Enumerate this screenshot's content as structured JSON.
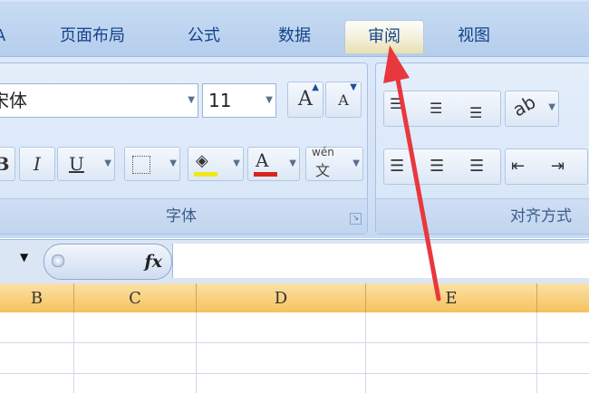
{
  "tabs": [
    {
      "label": "A"
    },
    {
      "label": "页面布局"
    },
    {
      "label": "公式"
    },
    {
      "label": "数据"
    },
    {
      "label": "审阅"
    },
    {
      "label": "视图"
    }
  ],
  "active_tab": "审阅",
  "font_group": {
    "font_name": "宋体",
    "font_size": "11",
    "grow_font_label": "A",
    "shrink_font_label": "A",
    "bold_label": "B",
    "italic_label": "I",
    "underline_label": "U",
    "font_color_label": "A",
    "phonetic_label": "wén",
    "label": "字体"
  },
  "alignment_group": {
    "label": "对齐方式"
  },
  "formula_bar": {
    "fx_label": "fx",
    "value": ""
  },
  "columns": [
    "B",
    "C",
    "D",
    "E"
  ],
  "colors": {
    "arrow": "#e8383d",
    "column_header": "#f6c25c",
    "tab_text": "#15428b"
  },
  "icons": [
    "dropdown-arrow-icon",
    "grow-font-icon",
    "shrink-font-icon",
    "border-icon",
    "fill-color-icon",
    "font-color-icon",
    "phonetic-icon",
    "align-top-icon",
    "align-middle-icon",
    "align-bottom-icon",
    "orientation-icon",
    "align-left-icon",
    "align-center-icon",
    "align-right-icon",
    "decrease-indent-icon",
    "increase-indent-icon",
    "dialog-launcher-icon",
    "fx-icon",
    "annotation-arrow"
  ]
}
